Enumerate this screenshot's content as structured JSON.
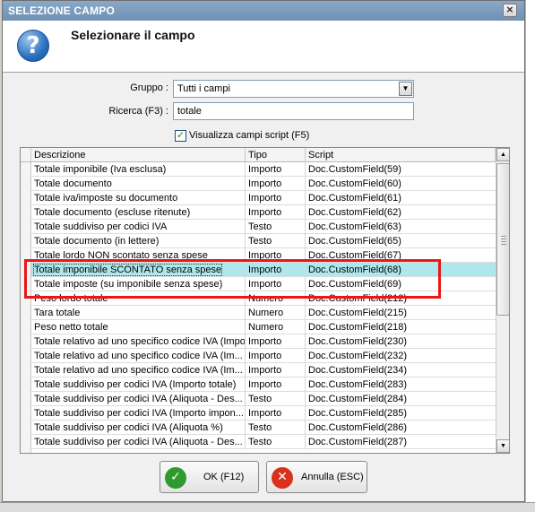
{
  "dialog": {
    "title": "SELEZIONE CAMPO",
    "heading": "Selezionare il campo",
    "close_glyph": "×"
  },
  "form": {
    "group_label": "Gruppo :",
    "group_value": "Tutti i campi",
    "search_label": "Ricerca (F3) :",
    "search_value": "totale",
    "script_checkbox_label": "Visualizza campi script (F5)",
    "script_checkbox_checked": true
  },
  "grid": {
    "columns": [
      "Descrizione",
      "Tipo",
      "Script"
    ],
    "selected_row": 7,
    "rows": [
      {
        "desc": "Totale imponibile (Iva esclusa)",
        "type": "Importo",
        "script": "Doc.CustomField(59)"
      },
      {
        "desc": "Totale documento",
        "type": "Importo",
        "script": "Doc.CustomField(60)"
      },
      {
        "desc": "Totale iva/imposte su documento",
        "type": "Importo",
        "script": "Doc.CustomField(61)"
      },
      {
        "desc": "Totale documento (escluse ritenute)",
        "type": "Importo",
        "script": "Doc.CustomField(62)"
      },
      {
        "desc": "Totale suddiviso per codici IVA",
        "type": "Testo",
        "script": "Doc.CustomField(63)"
      },
      {
        "desc": "Totale documento (in lettere)",
        "type": "Testo",
        "script": "Doc.CustomField(65)"
      },
      {
        "desc": "Totale lordo NON scontato senza spese",
        "type": "Importo",
        "script": "Doc.CustomField(67)"
      },
      {
        "desc": "Totale imponibile SCONTATO senza spese",
        "type": "Importo",
        "script": "Doc.CustomField(68)"
      },
      {
        "desc": "Totale imposte (su imponibile senza spese)",
        "type": "Importo",
        "script": "Doc.CustomField(69)"
      },
      {
        "desc": "Peso lordo totale",
        "type": "Numero",
        "script": "Doc.CustomField(212)"
      },
      {
        "desc": "Tara totale",
        "type": "Numero",
        "script": "Doc.CustomField(215)"
      },
      {
        "desc": "Peso netto totale",
        "type": "Numero",
        "script": "Doc.CustomField(218)"
      },
      {
        "desc": "Totale relativo ad uno specifico codice IVA (Impo...",
        "type": "Importo",
        "script": "Doc.CustomField(230)"
      },
      {
        "desc": "Totale relativo ad uno specifico codice IVA (Im...",
        "type": "Importo",
        "script": "Doc.CustomField(232)"
      },
      {
        "desc": "Totale relativo ad uno specifico codice IVA (Im...",
        "type": "Importo",
        "script": "Doc.CustomField(234)"
      },
      {
        "desc": "Totale suddiviso per codici IVA (Importo totale)",
        "type": "Importo",
        "script": "Doc.CustomField(283)"
      },
      {
        "desc": "Totale suddiviso per codici IVA (Aliquota - Des...",
        "type": "Testo",
        "script": "Doc.CustomField(284)"
      },
      {
        "desc": "Totale suddiviso per codici IVA (Importo impon...",
        "type": "Importo",
        "script": "Doc.CustomField(285)"
      },
      {
        "desc": "Totale suddiviso per codici IVA (Aliquota %)",
        "type": "Testo",
        "script": "Doc.CustomField(286)"
      },
      {
        "desc": "Totale suddiviso per codici IVA (Aliquota - Des...",
        "type": "Testo",
        "script": "Doc.CustomField(287)"
      }
    ]
  },
  "buttons": {
    "ok_label": "OK (F12)",
    "cancel_label": "Annulla (ESC)"
  },
  "colors": {
    "selected_row": "#aee8ec",
    "highlight_border": "#e81818",
    "ok_icon": "#2e9b2e",
    "cancel_icon": "#d8321e"
  }
}
